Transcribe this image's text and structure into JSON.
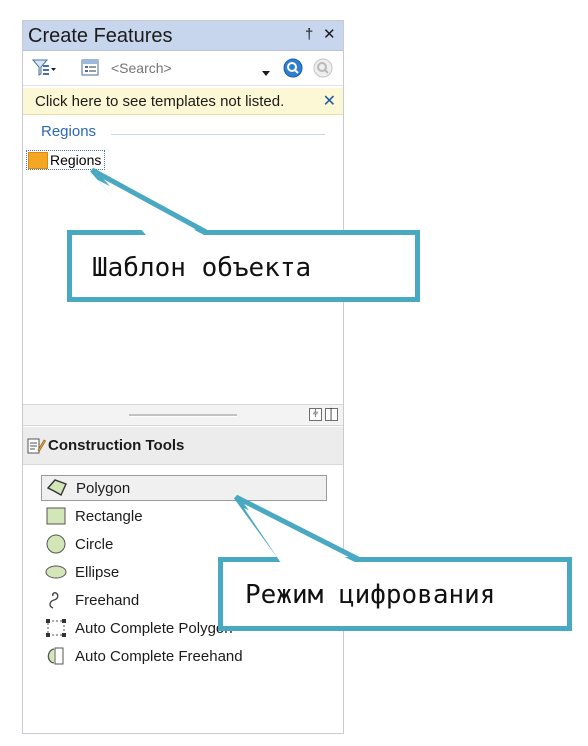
{
  "panel": {
    "title": "Create Features",
    "pin_label": "†",
    "close_label": "✕"
  },
  "toolbar": {
    "filter_icon": "filter-icon",
    "organize_icon": "organize-templates-icon",
    "search_placeholder": "<Search>",
    "search_button_icon": "search-icon",
    "clear_search_icon": "clear-search-icon"
  },
  "infobar": {
    "message": "Click here to see templates not listed.",
    "close_label": "✕"
  },
  "templates": {
    "group_header": "Regions",
    "items": [
      {
        "label": "Regions",
        "swatch_color": "#f5a623"
      }
    ]
  },
  "construction_tools": {
    "header": "Construction Tools",
    "tools": [
      {
        "label": "Polygon",
        "icon": "polygon-icon",
        "selected": true
      },
      {
        "label": "Rectangle",
        "icon": "rectangle-icon",
        "selected": false
      },
      {
        "label": "Circle",
        "icon": "circle-icon",
        "selected": false
      },
      {
        "label": "Ellipse",
        "icon": "ellipse-icon",
        "selected": false
      },
      {
        "label": "Freehand",
        "icon": "freehand-icon",
        "selected": false
      },
      {
        "label": "Auto Complete Polygon",
        "icon": "auto-complete-polygon-icon",
        "selected": false
      },
      {
        "label": "Auto Complete Freehand",
        "icon": "auto-complete-freehand-icon",
        "selected": false
      }
    ]
  },
  "callouts": {
    "template": "Шаблон объекта",
    "digitizing_mode": "Режим цифрования",
    "border_color": "#4aa9c2"
  }
}
